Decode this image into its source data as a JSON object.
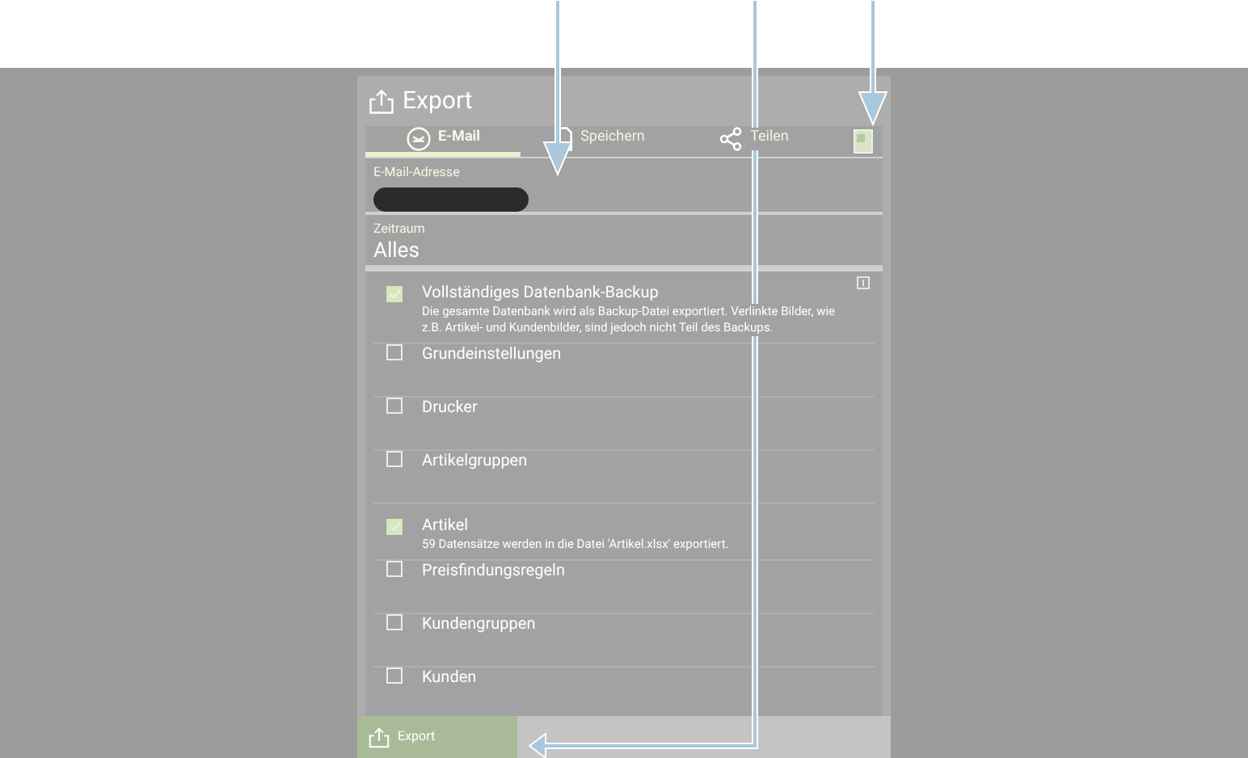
{
  "dialog": {
    "title": "Export"
  },
  "tabs": [
    {
      "label": "E-Mail",
      "selected": true
    },
    {
      "label": "Speichern",
      "selected": false
    },
    {
      "label": "Teilen",
      "selected": false
    }
  ],
  "email_field": {
    "label": "E-Mail-Adresse"
  },
  "period_field": {
    "label": "Zeitraum",
    "value": "Alles"
  },
  "items": [
    {
      "title": "Vollständiges Datenbank-Backup",
      "description": "Die gesamte Datenbank wird als Backup-Datei exportiert. Verlinkte Bilder, wie z.B. Artikel- und Kundenbilder, sind jedoch nicht Teil des Backups.",
      "checked": true,
      "info": true
    },
    {
      "title": "Grundeinstellungen",
      "checked": false,
      "info": false
    },
    {
      "title": "Drucker",
      "checked": false,
      "info": false
    },
    {
      "title": "Artikelgruppen",
      "checked": false,
      "info": false
    },
    {
      "title": "Artikel",
      "description": "59 Datensätze werden in die Datei 'Artikel.xlsx' exportiert.",
      "checked": true,
      "info": false
    },
    {
      "title": "Preisfindungsregeln",
      "checked": false,
      "info": false
    },
    {
      "title": "Kundengruppen",
      "checked": false,
      "info": false
    },
    {
      "title": "Kunden",
      "checked": false,
      "info": false
    }
  ],
  "footer": {
    "export_button": "Export"
  }
}
